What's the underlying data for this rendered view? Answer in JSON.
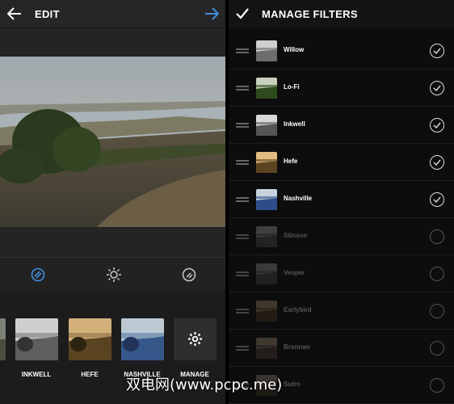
{
  "edit_screen": {
    "title": "EDIT",
    "tools": [
      "filter-tool",
      "lux-tool",
      "adjust-tool"
    ],
    "filters": [
      {
        "label": ""
      },
      {
        "label": "INKWELL"
      },
      {
        "label": "HEFE"
      },
      {
        "label": "NASHVILLE"
      },
      {
        "label": "MANAGE"
      }
    ]
  },
  "manage_screen": {
    "title": "MANAGE FILTERS",
    "filters": [
      {
        "name": "Willow",
        "enabled": true
      },
      {
        "name": "Lo-Fi",
        "enabled": true
      },
      {
        "name": "Inkwell",
        "enabled": true
      },
      {
        "name": "Hefe",
        "enabled": true
      },
      {
        "name": "Nashville",
        "enabled": true
      },
      {
        "name": "Stinson",
        "enabled": false
      },
      {
        "name": "Vesper",
        "enabled": false
      },
      {
        "name": "Earlybird",
        "enabled": false
      },
      {
        "name": "Brannan",
        "enabled": false
      },
      {
        "name": "Sutro",
        "enabled": false
      }
    ]
  },
  "watermark": "双电网(www.pcpc.me)",
  "colors": {
    "accent": "#3f8fe0",
    "bg_left": "#242424",
    "bg_right": "#0d0d0d"
  }
}
